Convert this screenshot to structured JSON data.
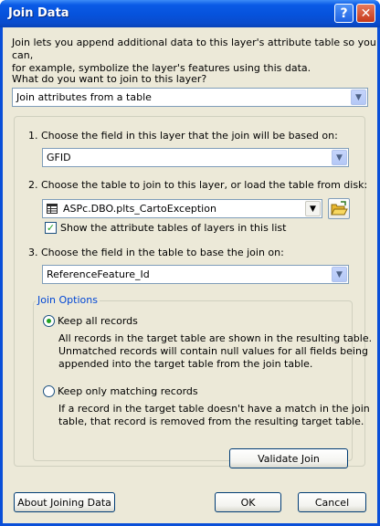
{
  "window": {
    "title": "Join Data",
    "help_button": "?",
    "close_button": "✕"
  },
  "intro": "Join lets you append additional data to this layer's attribute table so you can,\nfor example, symbolize the layer's features using this data.",
  "question": "What do you want to join to this layer?",
  "join_type": {
    "selected": "Join attributes from a table"
  },
  "step1": {
    "label": "1.  Choose the field in this layer that the join will be based on:",
    "selected": "GFID"
  },
  "step2": {
    "label": "2.  Choose the table to join to this layer, or load the table from disk:",
    "selected": "ASPc.DBO.plts_CartoException",
    "show_layers_label": "Show the attribute tables of layers in this list",
    "show_layers_checked": true
  },
  "step3": {
    "label": "3.  Choose the field in the table to base the join on:",
    "selected": "ReferenceFeature_Id"
  },
  "join_options": {
    "legend": "Join Options",
    "keep_all": {
      "label": "Keep all records",
      "selected": true,
      "description": "All records in the target table are shown in the resulting table.\nUnmatched records will contain null values for all fields being\nappended into the target table from the join table."
    },
    "keep_matching": {
      "label": "Keep only matching records",
      "selected": false,
      "description": "If a record in the target table doesn't have a match in the join\ntable, that record is removed from the resulting target table."
    }
  },
  "buttons": {
    "validate": "Validate Join",
    "about": "About Joining Data",
    "ok": "OK",
    "cancel": "Cancel"
  },
  "icons": {
    "arrow": "▼",
    "table": "table-icon",
    "folder": "open-folder-icon",
    "check": "✓"
  },
  "colors": {
    "titlebar": "#0652db",
    "face": "#ece9d8",
    "group_legend": "#0046d5",
    "check_green": "#21a121"
  }
}
